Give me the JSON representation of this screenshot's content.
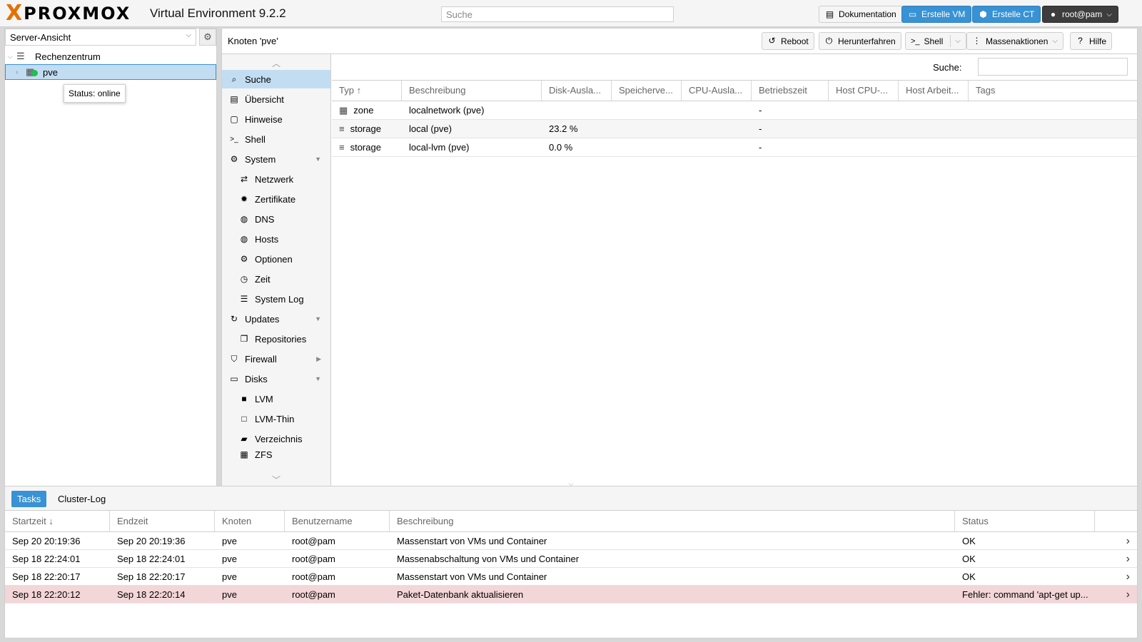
{
  "header": {
    "logo_x": "X",
    "logo_word": "PROXMOX",
    "version": "Virtual Environment 9.2.2",
    "search_placeholder": "Suche",
    "docs_label": "Dokumentation",
    "create_vm_label": "Erstelle VM",
    "create_ct_label": "Erstelle CT",
    "user_label": "root@pam"
  },
  "tree": {
    "view_select": "Server-Ansicht",
    "datacenter": "Rechenzentrum",
    "node": "pve",
    "tooltip": "Status: online"
  },
  "content": {
    "title": "Knoten 'pve'",
    "buttons": {
      "reboot": "Reboot",
      "shutdown": "Herunterfahren",
      "shell": "Shell",
      "bulk": "Massenaktionen",
      "help": "Hilfe"
    }
  },
  "nav": [
    {
      "label": "Suche",
      "icon": "search-icon"
    },
    {
      "label": "Übersicht",
      "icon": "book-icon"
    },
    {
      "label": "Hinweise",
      "icon": "note-icon"
    },
    {
      "label": "Shell",
      "icon": "terminal-icon"
    },
    {
      "label": "System",
      "icon": "cogs-icon"
    },
    {
      "label": "Netzwerk",
      "icon": "exchange-icon"
    },
    {
      "label": "Zertifikate",
      "icon": "certificate-icon"
    },
    {
      "label": "DNS",
      "icon": "globe-icon"
    },
    {
      "label": "Hosts",
      "icon": "globe-icon"
    },
    {
      "label": "Optionen",
      "icon": "gear-icon"
    },
    {
      "label": "Zeit",
      "icon": "clock-icon"
    },
    {
      "label": "System Log",
      "icon": "list-icon"
    },
    {
      "label": "Updates",
      "icon": "refresh-icon"
    },
    {
      "label": "Repositories",
      "icon": "files-icon"
    },
    {
      "label": "Firewall",
      "icon": "shield-icon"
    },
    {
      "label": "Disks",
      "icon": "hdd-icon"
    },
    {
      "label": "LVM",
      "icon": "square-icon"
    },
    {
      "label": "LVM-Thin",
      "icon": "square-outline-icon"
    },
    {
      "label": "Verzeichnis",
      "icon": "folder-icon"
    },
    {
      "label": "ZFS",
      "icon": "grid-icon"
    }
  ],
  "grid": {
    "search_label": "Suche:",
    "columns": [
      "Typ",
      "Beschreibung",
      "Disk-Ausla...",
      "Speicherve...",
      "CPU-Ausla...",
      "Betriebszeit",
      "Host CPU-...",
      "Host Arbeit...",
      "Tags"
    ],
    "rows": [
      {
        "type": "zone",
        "desc": "localnetwork (pve)",
        "disk": "",
        "uptime": "-"
      },
      {
        "type": "storage",
        "desc": "local (pve)",
        "disk": "23.2 %",
        "uptime": "-"
      },
      {
        "type": "storage",
        "desc": "local-lvm (pve)",
        "disk": "0.0 %",
        "uptime": "-"
      }
    ]
  },
  "log": {
    "tabs": [
      "Tasks",
      "Cluster-Log"
    ],
    "columns": [
      "Startzeit",
      "Endzeit",
      "Knoten",
      "Benutzername",
      "Beschreibung",
      "Status"
    ],
    "rows": [
      {
        "start": "Sep 20 20:19:36",
        "end": "Sep 20 20:19:36",
        "node": "pve",
        "user": "root@pam",
        "desc": "Massenstart von VMs und Container",
        "status": "OK"
      },
      {
        "start": "Sep 18 22:24:01",
        "end": "Sep 18 22:24:01",
        "node": "pve",
        "user": "root@pam",
        "desc": "Massenabschaltung von VMs und Container",
        "status": "OK"
      },
      {
        "start": "Sep 18 22:20:17",
        "end": "Sep 18 22:20:17",
        "node": "pve",
        "user": "root@pam",
        "desc": "Massenstart von VMs und Container",
        "status": "OK"
      },
      {
        "start": "Sep 18 22:20:12",
        "end": "Sep 18 22:20:14",
        "node": "pve",
        "user": "root@pam",
        "desc": "Paket-Datenbank aktualisieren",
        "status": "Fehler: command 'apt-get up..."
      }
    ]
  },
  "colors": {
    "accent": "#3892d4",
    "logo_orange": "#e57000",
    "error_row": "#f3d6d7",
    "selection": "#c2ddf2"
  }
}
